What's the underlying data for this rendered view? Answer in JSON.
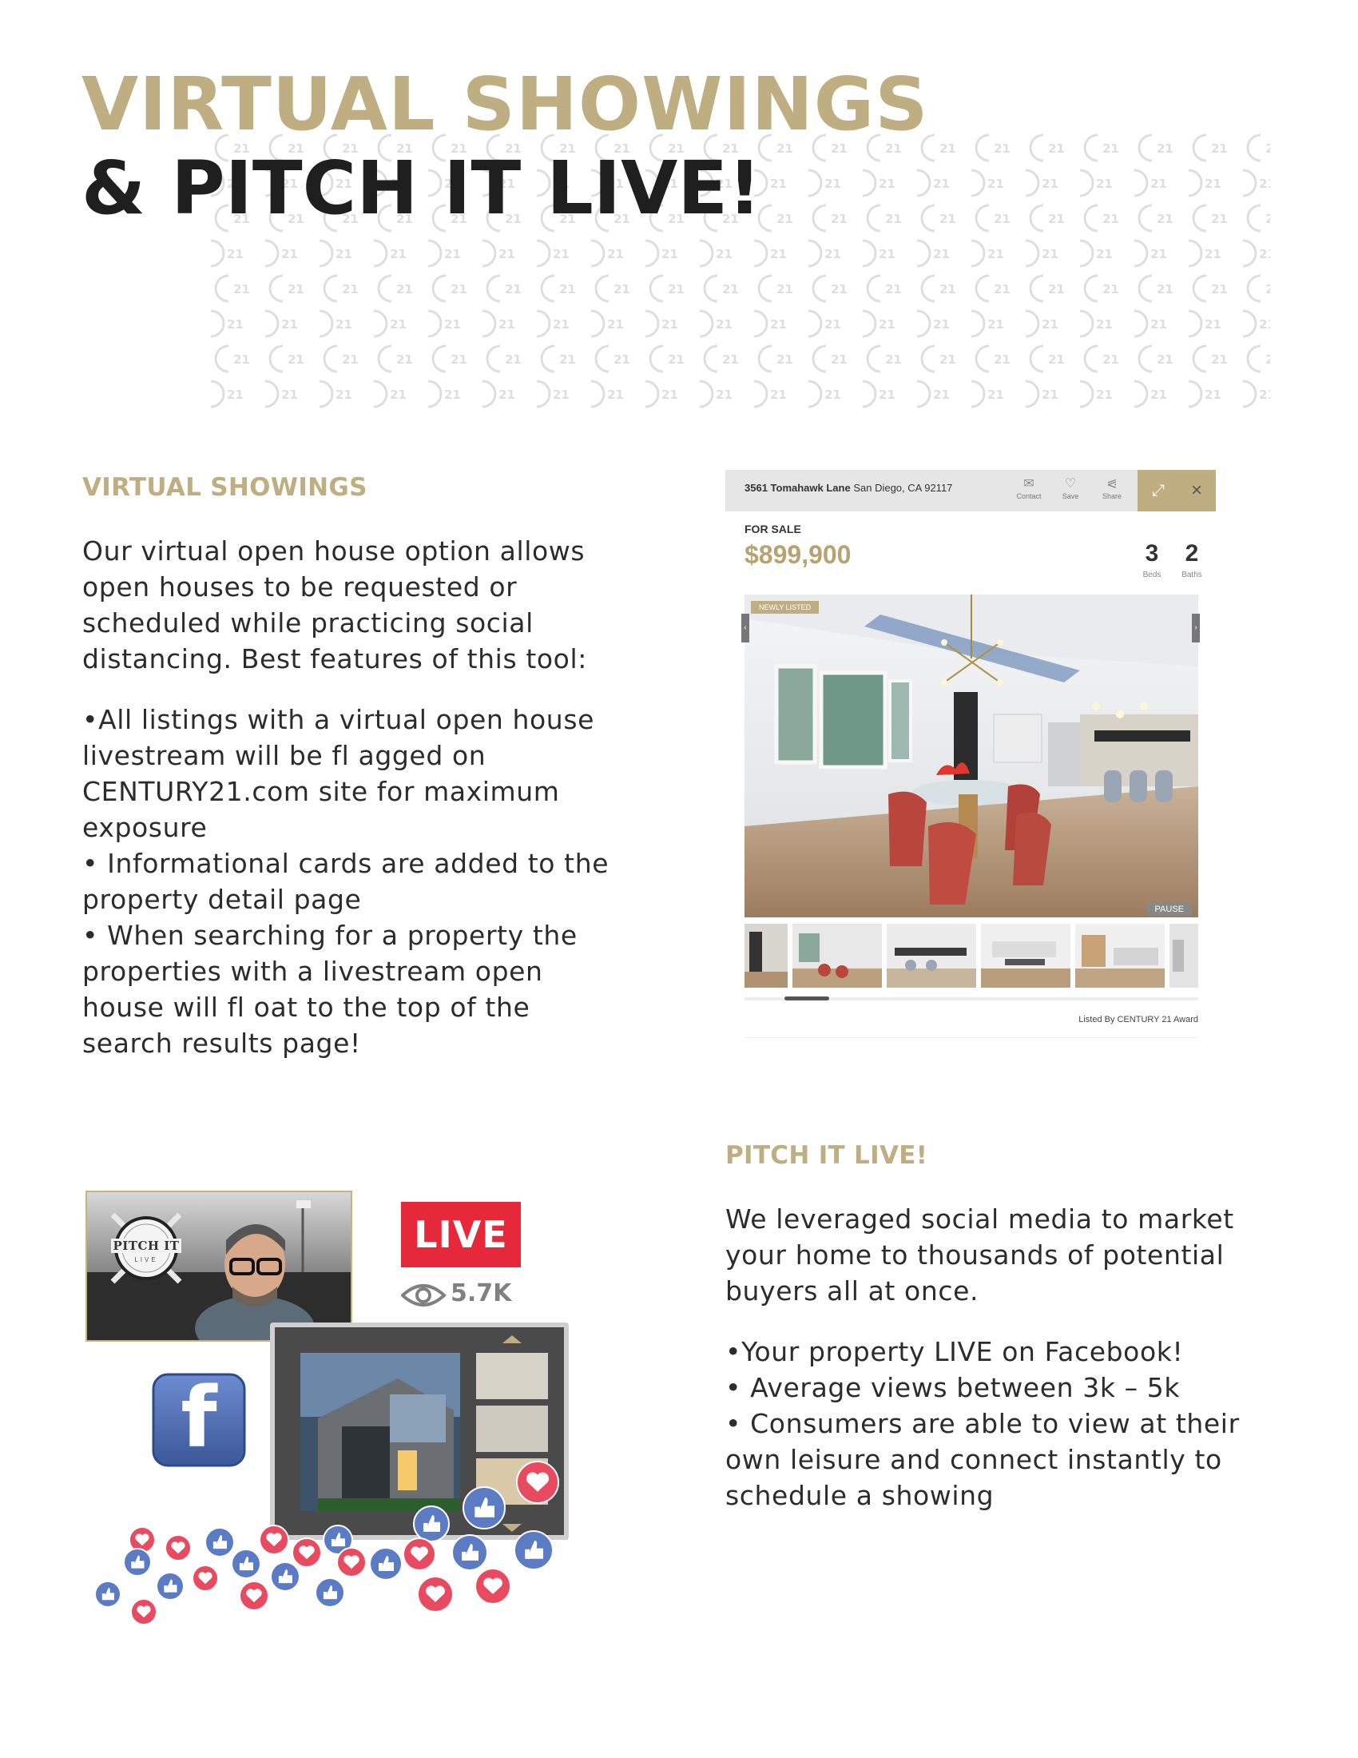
{
  "header": {
    "title_line1": "VIRTUAL SHOWINGS",
    "title_line2": "& PITCH IT LIVE!",
    "pattern_mark": "21"
  },
  "virtual_showings": {
    "heading": "VIRTUAL SHOWINGS",
    "intro_lines": [
      "Our virtual open house option allows",
      "open houses to be requested or",
      "scheduled while practicing social",
      "distancing. Best features of this tool:"
    ],
    "bullet_lines": [
      "•All listings with a virtual open house",
      "livestream will be fl agged on",
      "CENTURY21.com site for maximum",
      "exposure",
      "•  Informational cards are added to the",
      "property detail page",
      "•  When searching for a property the",
      "properties with a livestream open",
      "house will fl oat to the top of the",
      "search results page!"
    ]
  },
  "listing": {
    "address_street": "3561 Tomahawk Lane",
    "address_city": " San Diego, CA 92117",
    "actions": [
      {
        "label": "Contact",
        "icon": "mail-icon"
      },
      {
        "label": "Save",
        "icon": "heart-icon"
      },
      {
        "label": "Share",
        "icon": "share-icon"
      }
    ],
    "status": "FOR SALE",
    "price": "$899,900",
    "beds": "3",
    "beds_label": "Beds",
    "baths": "2",
    "baths_label": "Baths",
    "badge": "NEWLY LISTED",
    "pause_label": "PAUSE",
    "listed_by": "Listed By CENTURY 21 Award",
    "accent_color": "#bfae82"
  },
  "pitch_it_live": {
    "heading": "PITCH IT LIVE!",
    "intro_lines": [
      "We leveraged social media to market",
      "your home to thousands of potential",
      "buyers all at once."
    ],
    "bullet_lines": [
      "•Your property LIVE on Facebook!",
      "•  Average views between 3k – 5k",
      "•  Consumers are able to view at their",
      "own leisure and connect instantly to",
      "schedule a showing"
    ],
    "live_badge": "LIVE",
    "views_count": "5.7K",
    "logo_text": "PITCH IT",
    "logo_sub": "LIVE",
    "facebook_letter": "f",
    "live_color": "#e5293a",
    "like_color": "#5b7cc5",
    "heart_color": "#e84a5f"
  }
}
